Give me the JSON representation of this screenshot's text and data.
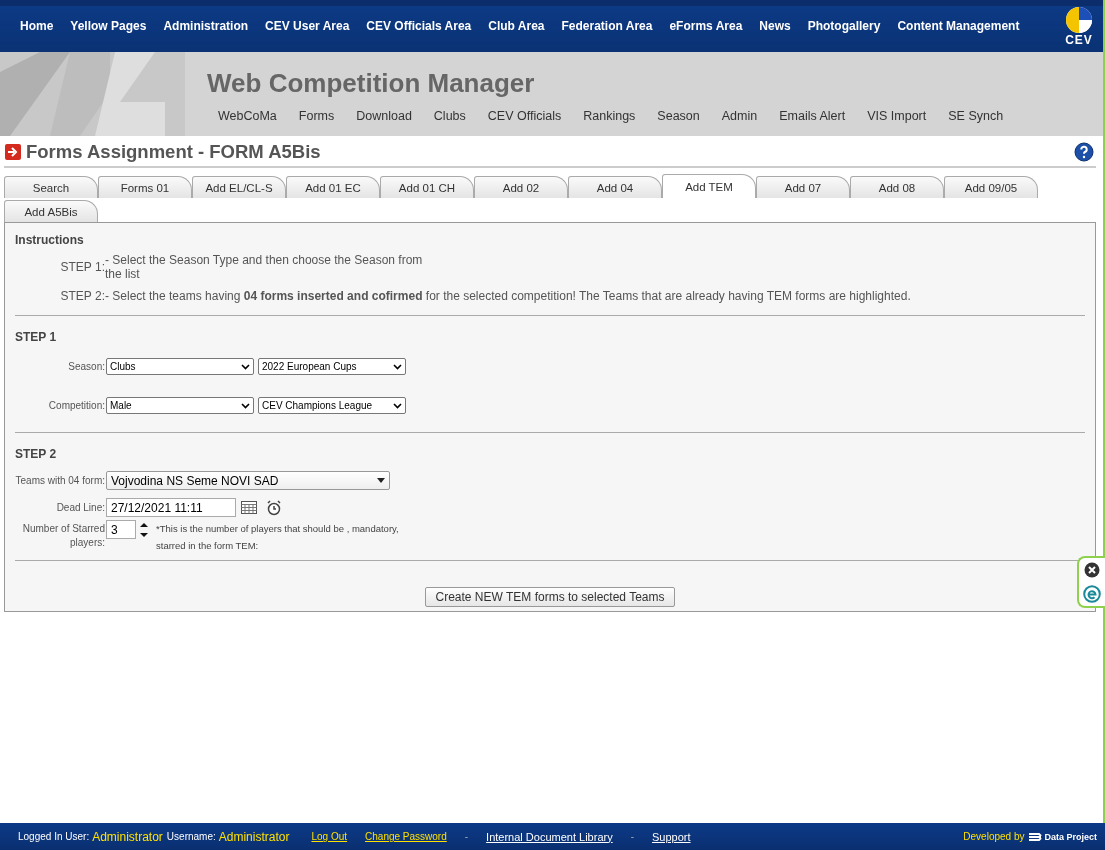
{
  "nav": {
    "items": [
      "Home",
      "Yellow Pages",
      "Administration",
      "CEV User Area",
      "CEV Officials Area",
      "Club Area",
      "Federation Area",
      "eForms Area",
      "News",
      "Photogallery",
      "Content Management"
    ],
    "logo_text": "CEV"
  },
  "banner": {
    "title": "Web Competition Manager",
    "menu": [
      "WebCoMa",
      "Forms",
      "Download",
      "Clubs",
      "CEV Officials",
      "Rankings",
      "Season",
      "Admin",
      "Emails Alert",
      "VIS Import",
      "SE Synch"
    ]
  },
  "page_title": "Forms Assignment - FORM A5Bis",
  "tabs": [
    {
      "label": "Search",
      "selected": false
    },
    {
      "label": "Forms 01",
      "selected": false
    },
    {
      "label": "Add EL/CL-S",
      "selected": false
    },
    {
      "label": "Add 01 EC",
      "selected": false
    },
    {
      "label": "Add 01 CH",
      "selected": false
    },
    {
      "label": "Add 02",
      "selected": false
    },
    {
      "label": "Add 04",
      "selected": false
    },
    {
      "label": "Add TEM",
      "selected": true
    },
    {
      "label": "Add 07",
      "selected": false
    },
    {
      "label": "Add 08",
      "selected": false
    },
    {
      "label": "Add 09/05",
      "selected": false
    },
    {
      "label": "Add A5Bis",
      "selected": false
    }
  ],
  "instructions": {
    "heading": "Instructions",
    "steps": [
      {
        "label": "STEP 1:",
        "text": "- Select the Season Type and then choose the Season from the list"
      },
      {
        "label": "STEP 2:",
        "text": "- Select the teams having **04 forms inserted and cofirmed** for the selected competition! The Teams that are already having TEM forms are highlighted."
      }
    ]
  },
  "step1": {
    "heading": "STEP 1",
    "rows": [
      {
        "label": "Season:",
        "selects": [
          "Clubs",
          "2022 European Cups"
        ]
      },
      {
        "label": "Competition:",
        "selects": [
          "Male",
          "CEV Champions League"
        ]
      }
    ]
  },
  "step2": {
    "heading": "STEP 2",
    "team_label": "Teams with 04 form:",
    "team": "Vojvodina NS Seme NOVI SAD",
    "deadline_label": "Dead Line:",
    "deadline": "27/12/2021 11:11",
    "starred_label": "Number of Starred players:",
    "starred": "3",
    "starred_note": "*This is the number of players that should be , mandatory, starred in the form TEM:"
  },
  "create_button": "Create NEW TEM forms to selected Teams",
  "footer": {
    "user_label": "Logged In User:",
    "user": "Administrator",
    "username_label": "Username:",
    "username": "Administrator",
    "links": [
      "Log Out",
      "Change Password",
      "Internal Document Library",
      "Support"
    ],
    "separators": [
      "-",
      "-"
    ],
    "developed_by": "Developed by",
    "brand": "Data Project"
  }
}
